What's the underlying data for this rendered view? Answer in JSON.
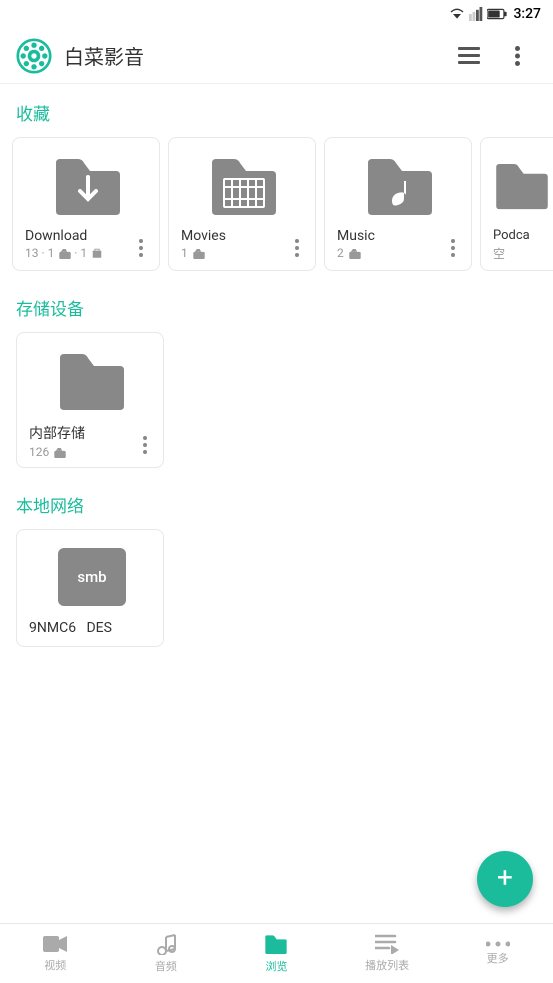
{
  "app": {
    "title": "白菜影音",
    "time": "3:27"
  },
  "toolbar": {
    "list_view_icon": "list-view",
    "more_icon": "more-vertical"
  },
  "sections": {
    "favorites": {
      "label": "收藏",
      "items": [
        {
          "name": "Download",
          "meta": "13 · 1",
          "type": "download"
        },
        {
          "name": "Movies",
          "meta": "1",
          "type": "movies"
        },
        {
          "name": "Music",
          "meta": "2",
          "type": "music"
        },
        {
          "name": "Podcasts",
          "meta": "空",
          "type": "podcasts"
        }
      ]
    },
    "storage": {
      "label": "存储设备",
      "items": [
        {
          "name": "内部存储",
          "meta": "126",
          "type": "folder"
        }
      ]
    },
    "network": {
      "label": "本地网络",
      "items": [
        {
          "name": "9NMC6",
          "meta": "DES",
          "type": "smb"
        }
      ]
    }
  },
  "fab": {
    "icon": "+"
  },
  "bottom_nav": {
    "items": [
      {
        "label": "视频",
        "icon": "video",
        "active": false
      },
      {
        "label": "音频",
        "icon": "music",
        "active": false
      },
      {
        "label": "浏览",
        "icon": "folder",
        "active": true
      },
      {
        "label": "播放列表",
        "icon": "playlist",
        "active": false
      },
      {
        "label": "更多",
        "icon": "more",
        "active": false
      }
    ]
  }
}
